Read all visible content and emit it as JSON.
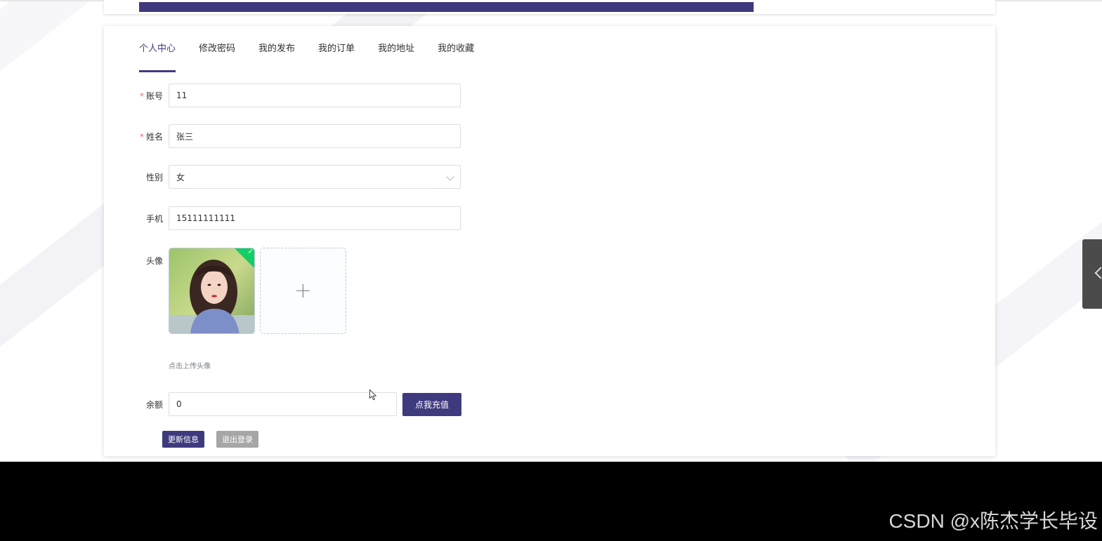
{
  "top_bar": {
    "progress_percent": 74.8
  },
  "tabs": [
    {
      "label": "个人中心",
      "active": true
    },
    {
      "label": "修改密码",
      "active": false
    },
    {
      "label": "我的发布",
      "active": false
    },
    {
      "label": "我的订单",
      "active": false
    },
    {
      "label": "我的地址",
      "active": false
    },
    {
      "label": "我的收藏",
      "active": false
    }
  ],
  "form": {
    "account": {
      "label": "账号",
      "required": "*",
      "value": "11"
    },
    "name": {
      "label": "姓名",
      "required": "*",
      "value": "张三"
    },
    "gender": {
      "label": "性别",
      "value": "女"
    },
    "phone": {
      "label": "手机",
      "value": "15111111111"
    },
    "avatar": {
      "label": "头像",
      "plus": "+",
      "check": "✓",
      "hint": "点击上传头像"
    },
    "balance": {
      "label": "余额",
      "value": "0",
      "recharge_button": "点我充值"
    }
  },
  "actions": {
    "update": "更新信息",
    "logout": "退出登录"
  },
  "watermark": "CSDN @x陈杰学长毕设",
  "colors": {
    "primary": "#3f3a7e",
    "grey_button": "#a6a6a6",
    "required": "#f56c6c",
    "success": "#13ce66"
  }
}
